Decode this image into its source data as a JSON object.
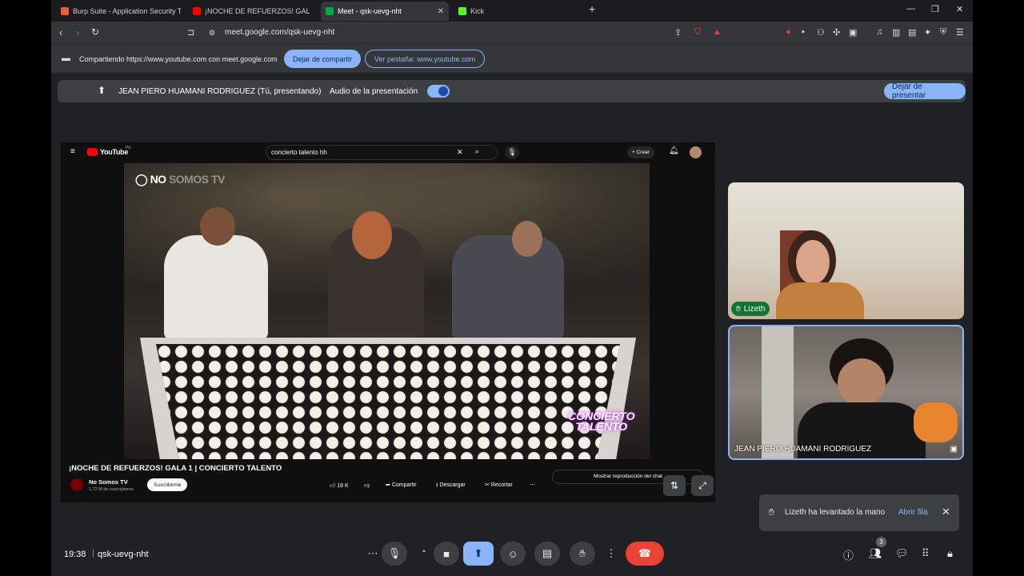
{
  "browser": {
    "tabs": [
      {
        "title": "Burp Suite - Application Security Testi",
        "color": "#e8622c"
      },
      {
        "title": "¡NOCHE DE REFUERZOS! GALA 1",
        "color": "#ff0000"
      },
      {
        "title": "Meet - qsk-uevg-nht",
        "color": "#00ac47"
      },
      {
        "title": "Kick",
        "color": "#53fc18"
      }
    ],
    "url": "meet.google.com/qsk-uevg-nht"
  },
  "sharebar": {
    "text": "Compartiendo https://www.youtube.com con meet.google.com",
    "stop_label": "Dejar de compartir",
    "view_tab_label": "Ver pestaña: www.youtube.com"
  },
  "presenting": {
    "name": "JEAN PIERO HUAMANI RODRIGUEZ (Tú, presentando)",
    "audio_label": "Audio de la presentación",
    "stop_label": "Dejar de presentar"
  },
  "youtube": {
    "logo_text": "YouTube",
    "country": "PE",
    "search_value": "concierto talento hh",
    "create_label": "Crear",
    "channel_overlay": "NO SOMOS TV",
    "channel_overlay_main": "NO",
    "channel_overlay_rest": "SOMOS TV",
    "talento_overlay_1": "CONCIERTO",
    "talento_overlay_2": "TALENTO",
    "video_title": "¡NOCHE DE REFUERZOS! GALA 1 | CONCIERTO TALENTO",
    "channel_name": "No Somos TV",
    "subscribers": "1,72 M de suscriptores",
    "subscribe_label": "Suscribirme",
    "likes": "18 K",
    "share_label": "Compartir",
    "download_label": "Descargar",
    "clip_label": "Recortar",
    "chat_replay_label": "Mostrar reproducción del chat"
  },
  "participants": [
    {
      "name": "Lizeth",
      "hand_raised": true
    },
    {
      "name": "JEAN PIERO HUAMANI RODRIGUEZ"
    }
  ],
  "notification": {
    "text": "Lizeth ha levantado la mano",
    "action": "Abrir fila"
  },
  "bottom": {
    "time": "19:38",
    "meeting_code": "qsk-uevg-nht",
    "participant_count": "3"
  }
}
